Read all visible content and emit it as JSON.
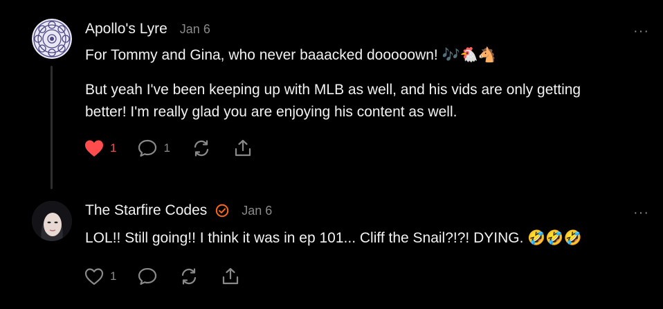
{
  "comments": [
    {
      "author": "Apollo's Lyre",
      "date": "Jan 6",
      "more": "···",
      "paragraphs": [
        "For Tommy and Gina, who never baaacked dooooown! 🎶🐔🐴",
        "But yeah I've been keeping up with MLB as well, and his vids are only getting better! I'm really glad you are enjoying his content as well."
      ],
      "likes": "1",
      "liked": true,
      "replies": "1",
      "icons": [
        "heart-icon",
        "comment-icon",
        "restack-icon",
        "share-icon"
      ]
    },
    {
      "author": "The Starfire Codes",
      "date": "Jan 6",
      "more": "···",
      "verified": true,
      "paragraphs": [
        "LOL!! Still going!! I think it was in ep 101... Cliff the Snail?!?! DYING. 🤣🤣🤣"
      ],
      "likes": "1",
      "liked": false,
      "icons": [
        "heart-icon",
        "comment-icon",
        "restack-icon",
        "share-icon"
      ]
    }
  ],
  "colors": {
    "background": "#000000",
    "text": "#f2f2f2",
    "muted": "#8a8a8a",
    "like_red": "#ff4d4d",
    "verified_orange": "#ff6719"
  }
}
